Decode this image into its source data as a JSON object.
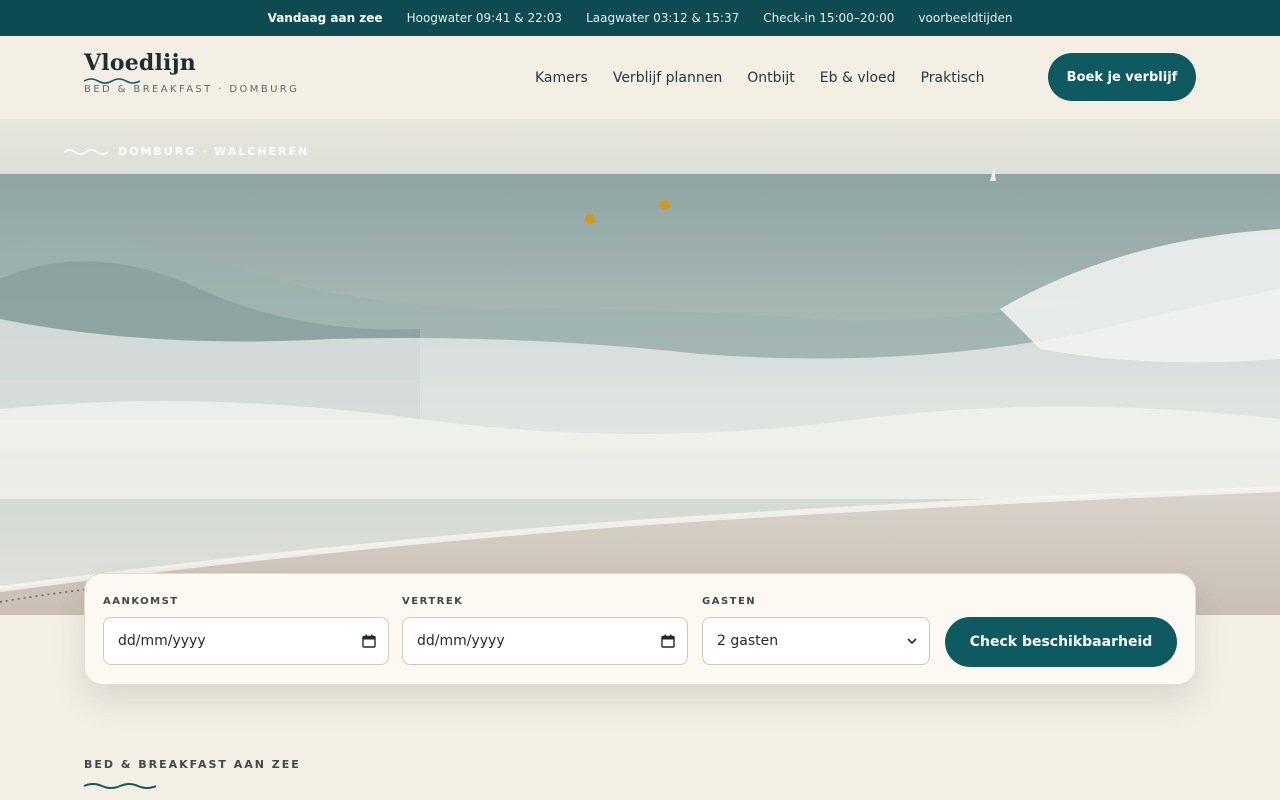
{
  "topbar": {
    "today": "Vandaag aan zee",
    "high_tide": "Hoogwater 09:41 & 22:03",
    "low_tide": "Laagwater 03:12 & 15:37",
    "checkin": "Check-in 15:00–20:00",
    "note": "voorbeeldtijden"
  },
  "brand": {
    "name": "Vloedlijn",
    "subtitle": "BED & BREAKFAST · DOMBURG"
  },
  "nav": {
    "items": [
      {
        "label": "Kamers"
      },
      {
        "label": "Verblijf plannen"
      },
      {
        "label": "Ontbijt"
      },
      {
        "label": "Eb & vloed"
      },
      {
        "label": "Praktisch"
      }
    ],
    "cta": "Boek je verblijf"
  },
  "hero": {
    "eyebrow": "DOMBURG · WALCHEREN"
  },
  "booking": {
    "arrival_label": "AANKOMST",
    "arrival_value": "dd/mm/yyyy",
    "departure_label": "VERTREK",
    "departure_value": "dd/mm/yyyy",
    "guests_label": "GASTEN",
    "guests_value": "2 gasten",
    "submit": "Check beschikbaarheid"
  },
  "section": {
    "eyebrow": "BED & BREAKFAST AAN ZEE"
  },
  "colors": {
    "primary": "#0f5a61",
    "topbar": "#0d4a51",
    "background": "#f3efe5"
  }
}
